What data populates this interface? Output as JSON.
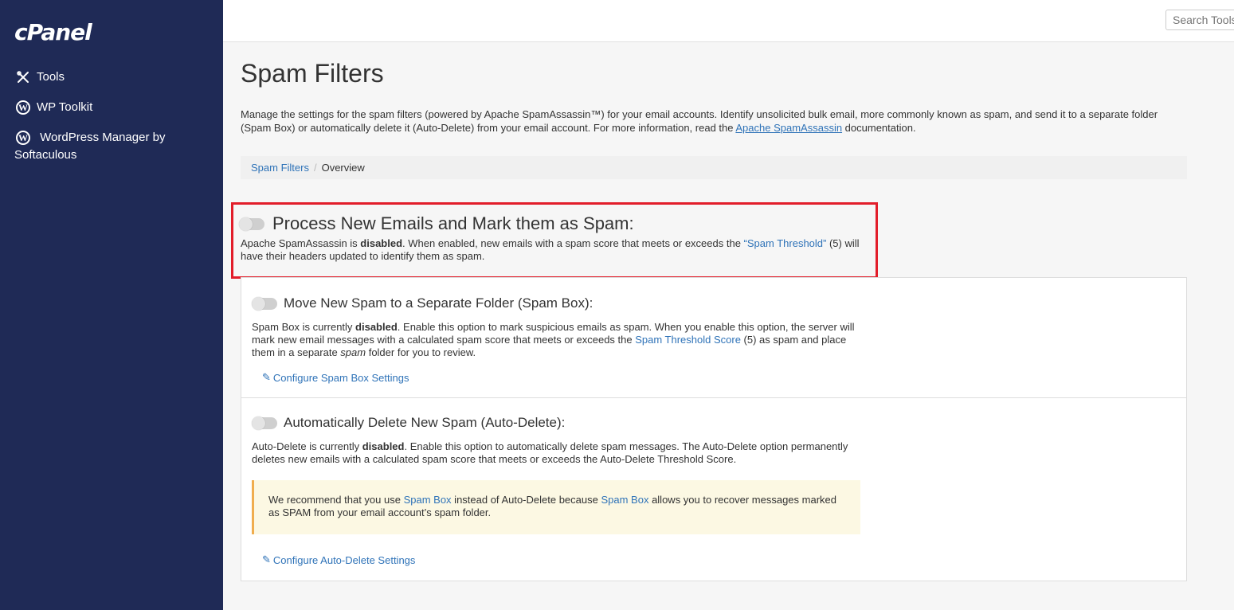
{
  "sidebar": {
    "logo": "cPanel",
    "items": [
      {
        "label": "Tools"
      },
      {
        "label": "WP Toolkit"
      },
      {
        "label": "WordPress Manager by Softaculous"
      }
    ]
  },
  "header": {
    "search_placeholder": "Search Tools"
  },
  "page": {
    "title": "Spam Filters",
    "intro_part1": "Manage the settings for the spam filters (powered by Apache SpamAssassin™) for your email accounts. Identify unsolicited bulk email, more commonly known as spam, and send it to a separate folder (Spam Box) or automatically delete it (Auto-Delete) from your email account. For more information, read the ",
    "intro_link": "Apache SpamAssassin",
    "intro_part2": " documentation."
  },
  "breadcrumb": {
    "root": "Spam Filters",
    "current": "Overview"
  },
  "process": {
    "title": "Process New Emails and Mark them as Spam:",
    "desc_a": "Apache SpamAssassin is ",
    "status": "disabled",
    "desc_b": ". When enabled, new emails with a spam score that meets or exceeds the ",
    "link": "“Spam Threshold”",
    "desc_c": " (5) will have their headers updated to identify them as spam.",
    "enabled": false
  },
  "spambox": {
    "title": "Move New Spam to a Separate Folder (Spam Box):",
    "desc_a": "Spam Box is currently ",
    "status": "disabled",
    "desc_b": ". Enable this option to mark suspicious emails as spam. When you enable this option, the server will mark new email messages with a calculated spam score that meets or exceeds the ",
    "link": "Spam Threshold Score",
    "desc_c": " (5) as spam and place them in a separate ",
    "em": "spam",
    "desc_d": " folder for you to review.",
    "configure": "Configure Spam Box Settings",
    "enabled": false
  },
  "autodelete": {
    "title": "Automatically Delete New Spam (Auto-Delete):",
    "desc_a": "Auto-Delete is currently ",
    "status": "disabled",
    "desc_b": ". Enable this option to automatically delete spam messages. The Auto-Delete option permanently deletes new emails with a calculated spam score that meets or exceeds the Auto-Delete Threshold Score.",
    "alert_a": "We recommend that you use ",
    "alert_link1": "Spam Box",
    "alert_b": " instead of Auto-Delete because ",
    "alert_link2": "Spam Box",
    "alert_c": " allows you to recover messages marked as SPAM from your email account’s spam folder.",
    "configure": "Configure Auto-Delete Settings",
    "enabled": false
  },
  "colors": {
    "sidebar_bg": "#1f2a56",
    "link": "#2f73b8",
    "highlight": "#e21d2a",
    "alert_bg": "#fcf8e3"
  }
}
